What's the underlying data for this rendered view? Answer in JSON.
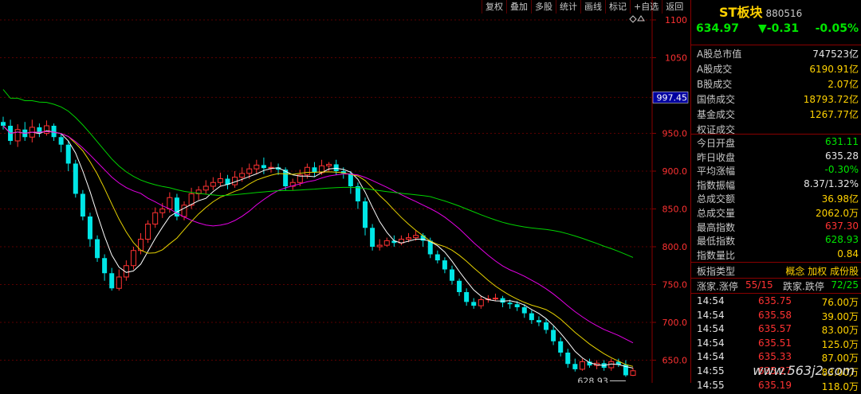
{
  "toolbar": [
    "复权",
    "叠加",
    "多股",
    "统计",
    "画线",
    "标记",
    "+自选",
    "返回"
  ],
  "chart": {
    "y_labels": [
      "1100",
      "1050",
      "997.45",
      "950.0",
      "900.0",
      "850.0",
      "800.0",
      "750.0",
      "700.0",
      "650.0"
    ],
    "y_ticks": [
      1100,
      1050,
      950,
      900,
      850,
      800,
      750,
      700,
      650
    ],
    "current_line_value": 997.45,
    "low_marker": "628.93",
    "colors": {
      "up": "#ff3232",
      "down": "#00e6e6",
      "ma5": "#ffffff",
      "ma10": "#e6d200",
      "ma20": "#e600e6",
      "ma60": "#00d200"
    }
  },
  "chart_data": {
    "type": "candlestick",
    "candles": [
      [
        965,
        960,
        972,
        955
      ],
      [
        960,
        940,
        968,
        935
      ],
      [
        940,
        955,
        962,
        932
      ],
      [
        955,
        945,
        965,
        940
      ],
      [
        945,
        958,
        968,
        938
      ],
      [
        958,
        950,
        963,
        945
      ],
      [
        950,
        960,
        967,
        947
      ],
      [
        960,
        945,
        963,
        940
      ],
      [
        945,
        935,
        950,
        925
      ],
      [
        935,
        910,
        940,
        900
      ],
      [
        910,
        870,
        915,
        865
      ],
      [
        870,
        840,
        875,
        835
      ],
      [
        840,
        810,
        845,
        800
      ],
      [
        810,
        785,
        815,
        780
      ],
      [
        785,
        765,
        790,
        755
      ],
      [
        765,
        745,
        772,
        742
      ],
      [
        745,
        760,
        770,
        742
      ],
      [
        760,
        775,
        782,
        755
      ],
      [
        775,
        795,
        800,
        770
      ],
      [
        795,
        810,
        818,
        790
      ],
      [
        810,
        830,
        835,
        805
      ],
      [
        830,
        845,
        852,
        825
      ],
      [
        845,
        850,
        858,
        838
      ],
      [
        850,
        865,
        872,
        845
      ],
      [
        865,
        840,
        870,
        835
      ],
      [
        840,
        855,
        860,
        835
      ],
      [
        855,
        870,
        878,
        850
      ],
      [
        870,
        875,
        880,
        862
      ],
      [
        875,
        880,
        888,
        870
      ],
      [
        880,
        885,
        892,
        875
      ],
      [
        885,
        890,
        898,
        880
      ],
      [
        890,
        882,
        895,
        876
      ],
      [
        882,
        892,
        900,
        878
      ],
      [
        892,
        897,
        905,
        886
      ],
      [
        897,
        903,
        910,
        890
      ],
      [
        903,
        908,
        915,
        896
      ],
      [
        908,
        904,
        918,
        896
      ],
      [
        904,
        905,
        912,
        898
      ],
      [
        905,
        902,
        910,
        895
      ],
      [
        902,
        880,
        905,
        875
      ],
      [
        880,
        885,
        890,
        875
      ],
      [
        885,
        895,
        902,
        880
      ],
      [
        895,
        905,
        910,
        890
      ],
      [
        905,
        898,
        912,
        892
      ],
      [
        898,
        907,
        915,
        895
      ],
      [
        907,
        909,
        912,
        900
      ],
      [
        909,
        900,
        915,
        895
      ],
      [
        900,
        897,
        905,
        890
      ],
      [
        897,
        880,
        900,
        870
      ],
      [
        880,
        860,
        885,
        850
      ],
      [
        860,
        825,
        865,
        815
      ],
      [
        825,
        800,
        830,
        795
      ],
      [
        800,
        802,
        810,
        795
      ],
      [
        802,
        808,
        812,
        800
      ],
      [
        808,
        805,
        815,
        800
      ],
      [
        805,
        810,
        815,
        802
      ],
      [
        810,
        812,
        818,
        806
      ],
      [
        812,
        815,
        822,
        808
      ],
      [
        815,
        808,
        818,
        800
      ],
      [
        808,
        790,
        812,
        785
      ],
      [
        790,
        782,
        795,
        778
      ],
      [
        782,
        770,
        786,
        765
      ],
      [
        770,
        755,
        775,
        750
      ],
      [
        755,
        740,
        758,
        735
      ],
      [
        740,
        727,
        745,
        722
      ],
      [
        727,
        722,
        732,
        718
      ],
      [
        722,
        730,
        735,
        718
      ],
      [
        730,
        731,
        736,
        726
      ],
      [
        731,
        732,
        738,
        728
      ],
      [
        732,
        726,
        735,
        720
      ],
      [
        726,
        724,
        730,
        718
      ],
      [
        724,
        720,
        728,
        715
      ],
      [
        720,
        712,
        724,
        706
      ],
      [
        712,
        703,
        716,
        698
      ],
      [
        703,
        700,
        708,
        695
      ],
      [
        700,
        690,
        705,
        685
      ],
      [
        690,
        675,
        695,
        670
      ],
      [
        675,
        660,
        680,
        655
      ],
      [
        660,
        645,
        665,
        640
      ],
      [
        645,
        638,
        652,
        635
      ],
      [
        638,
        648,
        652,
        636
      ],
      [
        648,
        643,
        652,
        640
      ],
      [
        643,
        646,
        650,
        638
      ],
      [
        646,
        640,
        650,
        636
      ],
      [
        640,
        648,
        652,
        636
      ],
      [
        648,
        644,
        652,
        641
      ],
      [
        644,
        630,
        650,
        628
      ],
      [
        630,
        636,
        640,
        629
      ]
    ],
    "ylim": [
      620,
      1120
    ]
  },
  "panel": {
    "name": "ST板块",
    "code": "880516",
    "price": "634.97",
    "change": "▼-0.31",
    "change_pct": "-0.05%",
    "market_rows": [
      {
        "label": "A股总市值",
        "value": "747523亿",
        "cls": "white"
      },
      {
        "label": "A股成交",
        "value": "6190.91亿",
        "cls": "yellow"
      },
      {
        "label": "B股成交",
        "value": "2.07亿",
        "cls": "yellow"
      },
      {
        "label": "国债成交",
        "value": "18793.72亿",
        "cls": "yellow"
      },
      {
        "label": "基金成交",
        "value": "1267.77亿",
        "cls": "yellow"
      },
      {
        "label": "权证成交",
        "value": "",
        "cls": "yellow"
      }
    ],
    "stat_rows": [
      {
        "label": "今日开盘",
        "value": "631.11",
        "cls": "green"
      },
      {
        "label": "昨日收盘",
        "value": "635.28",
        "cls": "white"
      },
      {
        "label": "平均涨幅",
        "value": "-0.30%",
        "cls": "green"
      },
      {
        "label": "指数振幅",
        "value": "8.37/1.32%",
        "cls": "white"
      },
      {
        "label": "总成交额",
        "value": "36.98亿",
        "cls": "yellow"
      },
      {
        "label": "总成交量",
        "value": "2062.0万",
        "cls": "yellow"
      },
      {
        "label": "最高指数",
        "value": "637.30",
        "cls": "red"
      },
      {
        "label": "最低指数",
        "value": "628.93",
        "cls": "green"
      },
      {
        "label": "指数量比",
        "value": "0.84",
        "cls": "yellow"
      }
    ],
    "type_row": {
      "label": "板指类型",
      "value": "概念 加权 成份股"
    },
    "updown": {
      "up_label": "涨家.涨停",
      "up_value": "55/15",
      "down_label": "跌家.跌停",
      "down_value": "72/25"
    },
    "trades": [
      {
        "time": "14:54",
        "price": "635.75",
        "vol": "76.00万"
      },
      {
        "time": "14:54",
        "price": "635.58",
        "vol": "39.00万"
      },
      {
        "time": "14:54",
        "price": "635.57",
        "vol": "83.00万"
      },
      {
        "time": "14:54",
        "price": "635.51",
        "vol": "125.0万"
      },
      {
        "time": "14:54",
        "price": "635.33",
        "vol": "87.00万"
      },
      {
        "time": "14:55",
        "price": "635.27",
        "vol": "83.00万"
      },
      {
        "time": "14:55",
        "price": "635.19",
        "vol": "118.0万"
      }
    ],
    "watermark": "www.563j2.com"
  }
}
